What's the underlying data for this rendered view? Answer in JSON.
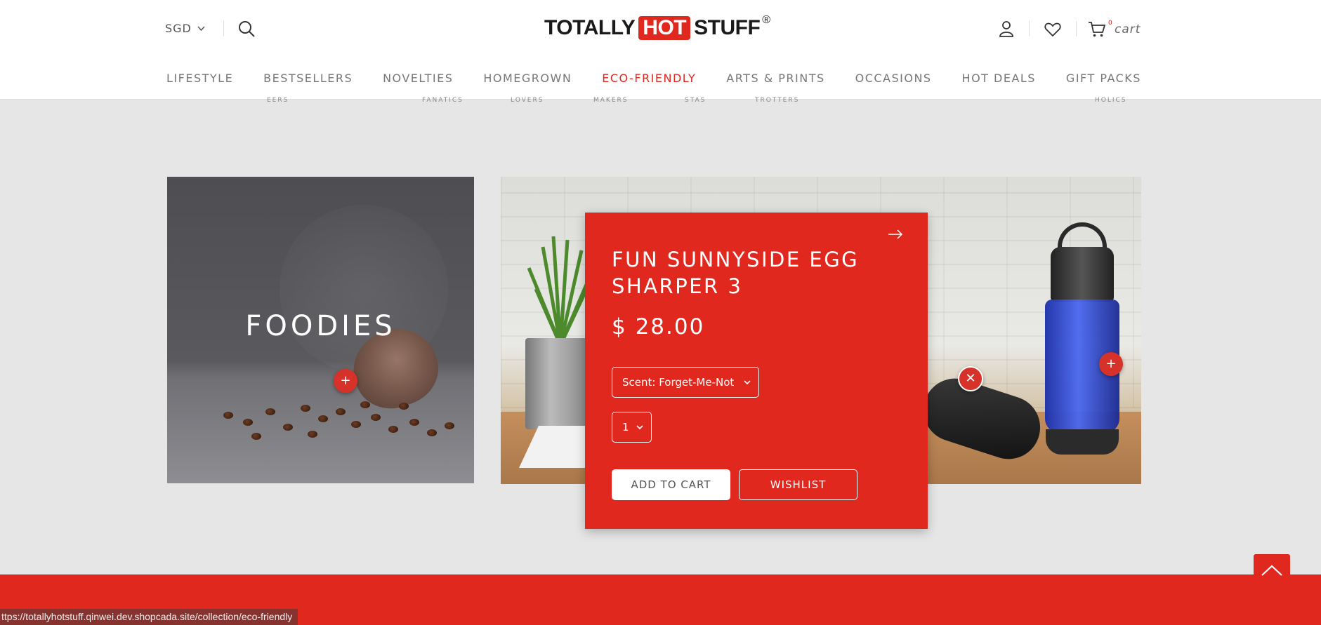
{
  "header": {
    "currency": "SGD",
    "logo": {
      "left": "TOTALLY",
      "middle": "HOT",
      "right": "STUFF",
      "reg": "®"
    },
    "cart_count": "0",
    "cart_label": "cart"
  },
  "nav": [
    {
      "label": "LIFESTYLE"
    },
    {
      "label": "BESTSELLERS"
    },
    {
      "label": "NOVELTIES"
    },
    {
      "label": "HOMEGROWN"
    },
    {
      "label": "ECO-FRIENDLY",
      "active": true
    },
    {
      "label": "ARTS & PRINTS"
    },
    {
      "label": "OCCASIONS"
    },
    {
      "label": "HOT DEALS"
    },
    {
      "label": "GIFT PACKS"
    }
  ],
  "subnav": [
    "EERS",
    "FANATICS",
    "LOVERS",
    "MAKERS",
    "STAS",
    "TROTTERS",
    "HOLICS"
  ],
  "foodies": {
    "title": "FOODIES",
    "plus": "+"
  },
  "wide_card": {
    "plus": "+",
    "close": "✕"
  },
  "popup": {
    "title": "FUN SUNNYSIDE EGG SHARPER 3",
    "price": "$ 28.00",
    "scent": "Scent: Forget-Me-Not",
    "quantity": "1",
    "add_to_cart": "ADD TO CART",
    "wishlist": "WISHLIST"
  },
  "status_bar": {
    "url": "ttps://totallyhotstuff.qinwei.dev.shopcada.site/collection/eco-friendly"
  },
  "colors": {
    "brand_red": "#e0281f",
    "text_grey": "#777777"
  }
}
